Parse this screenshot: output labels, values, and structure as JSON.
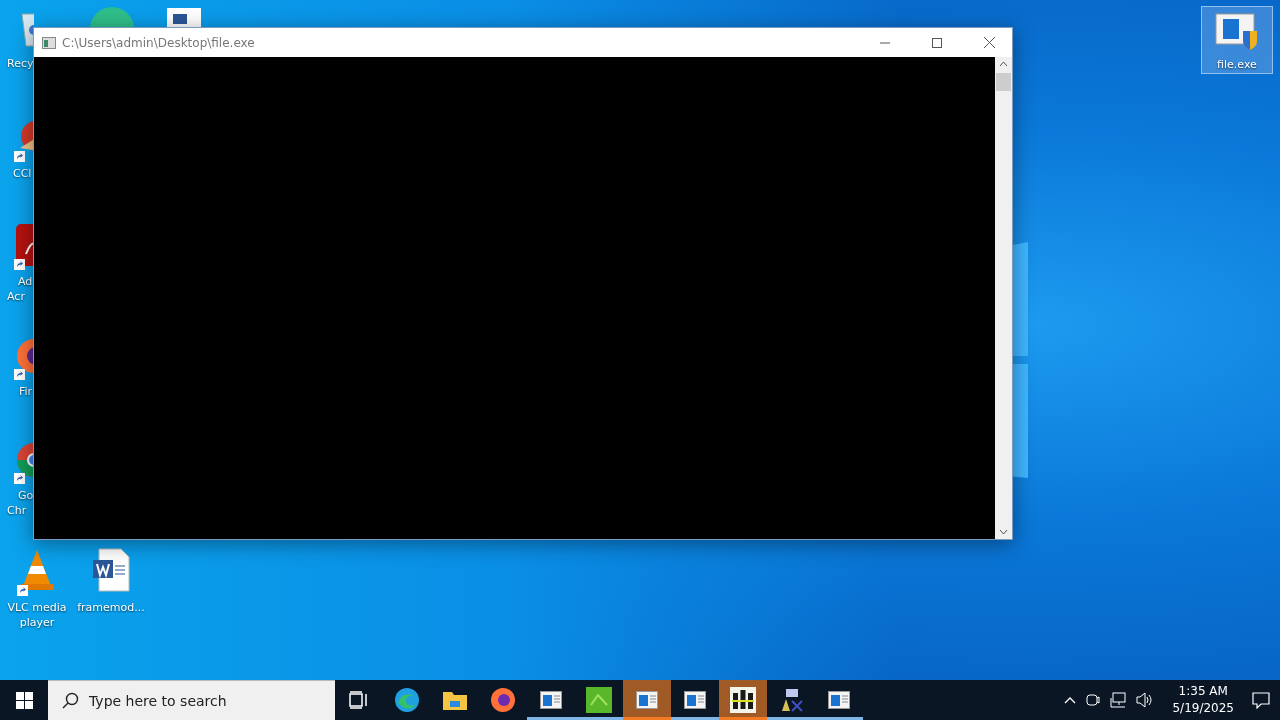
{
  "desktop_icons": [
    {
      "kind": "recycle",
      "lines": [
        "Recy"
      ],
      "shortcut": false
    },
    {
      "kind": "ccleaner",
      "lines": [
        "CCl"
      ],
      "shortcut": true
    },
    {
      "kind": "acrobat",
      "lines": [
        "Ad",
        "Acr"
      ],
      "shortcut": true
    },
    {
      "kind": "firefox",
      "lines": [
        "Fir"
      ],
      "shortcut": true
    },
    {
      "kind": "chrome",
      "lines": [
        "Go",
        "Chr"
      ],
      "shortcut": true
    },
    {
      "kind": "vlc",
      "lines": [
        "VLC media",
        "player"
      ],
      "shortcut": true
    },
    {
      "kind": "word",
      "lines": [
        "framemod..."
      ],
      "shortcut": false
    }
  ],
  "selected_icon": {
    "label": "file.exe",
    "selected": true
  },
  "window": {
    "title": "C:\\Users\\admin\\Desktop\\file.exe"
  },
  "taskbar": {
    "search": {
      "placeholder": "Type here to search"
    },
    "apps": [
      {
        "kind": "taskview",
        "running": false,
        "active": false
      },
      {
        "kind": "edge",
        "running": false,
        "active": false
      },
      {
        "kind": "explorer",
        "running": false,
        "active": false
      },
      {
        "kind": "firefox",
        "running": false,
        "active": false
      },
      {
        "kind": "app",
        "running": true,
        "active": false
      },
      {
        "kind": "bh",
        "running": true,
        "active": false
      },
      {
        "kind": "app",
        "running": true,
        "active": true
      },
      {
        "kind": "app",
        "running": true,
        "active": false
      },
      {
        "kind": "bottles",
        "running": true,
        "active": true
      },
      {
        "kind": "wizard",
        "running": true,
        "active": false
      },
      {
        "kind": "app",
        "running": true,
        "active": false
      }
    ],
    "time": "1:35 AM",
    "date": "5/19/2025"
  }
}
